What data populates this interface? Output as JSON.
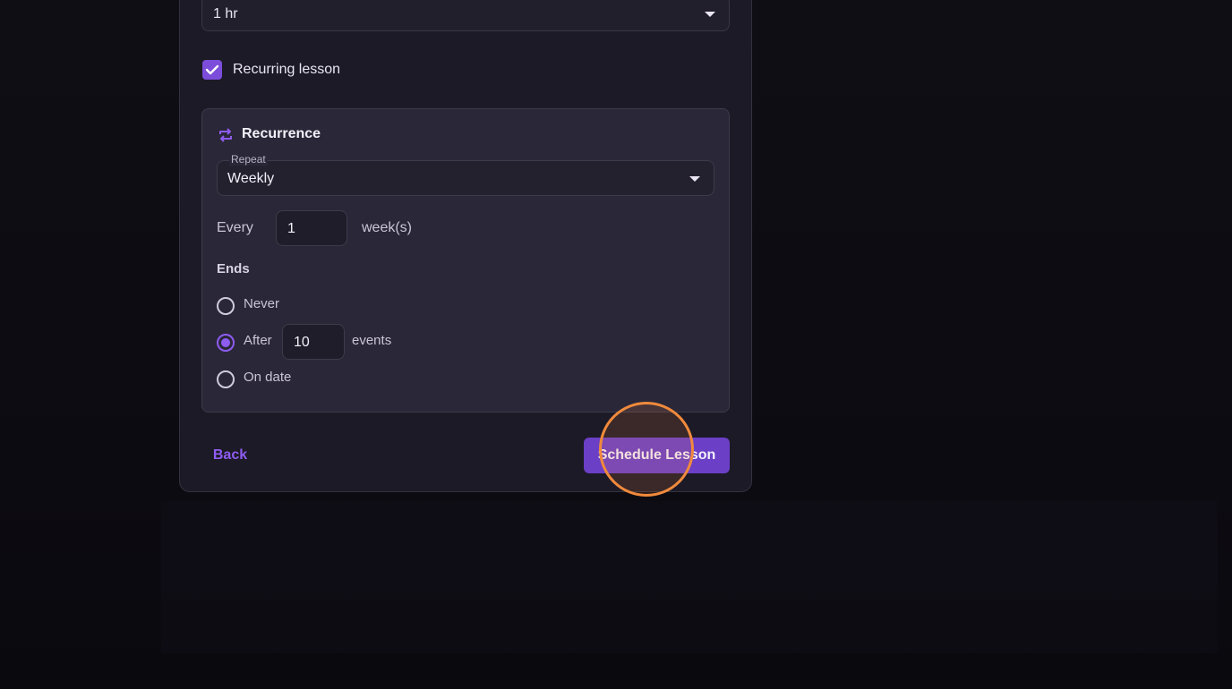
{
  "duration_select": {
    "value": "1 hr",
    "icon": "chevron-down-icon"
  },
  "recurring_checkbox": {
    "label": "Recurring lesson",
    "checked": true
  },
  "recurrence": {
    "title": "Recurrence",
    "icon": "repeat-icon",
    "repeat": {
      "legend": "Repeat",
      "value": "Weekly"
    },
    "every": {
      "label": "Every",
      "value": "1",
      "unit": "week(s)"
    },
    "ends": {
      "label": "Ends",
      "options": [
        {
          "label": "Never",
          "selected": false
        },
        {
          "label": "After",
          "selected": true,
          "value": "10",
          "suffix": "events"
        },
        {
          "label": "On date",
          "selected": false
        }
      ]
    }
  },
  "actions": {
    "back_label": "Back",
    "schedule_label": "Schedule Lesson"
  },
  "colors": {
    "accent": "#8e5cf0",
    "primary_button": "#6b3fc6",
    "click_indicator": "#f08a3c"
  }
}
